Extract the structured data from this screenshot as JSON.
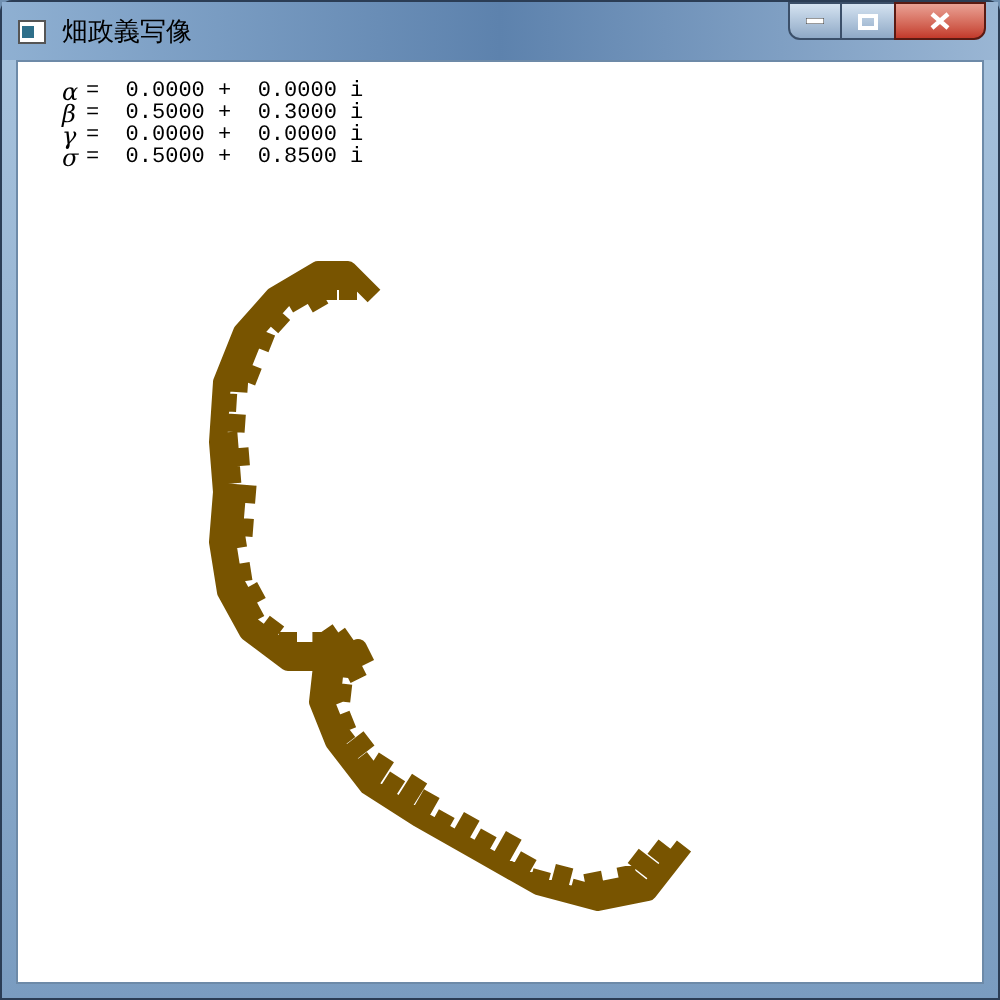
{
  "window": {
    "title": "畑政義写像"
  },
  "parameters": [
    {
      "symbol": "α",
      "value": "=  0.0000 +  0.0000 i"
    },
    {
      "symbol": "β",
      "value": "=  0.5000 +  0.3000 i"
    },
    {
      "symbol": "γ",
      "value": "=  0.0000 +  0.0000 i"
    },
    {
      "symbol": "σ",
      "value": "=  0.5000 +  0.8500 i"
    }
  ]
}
